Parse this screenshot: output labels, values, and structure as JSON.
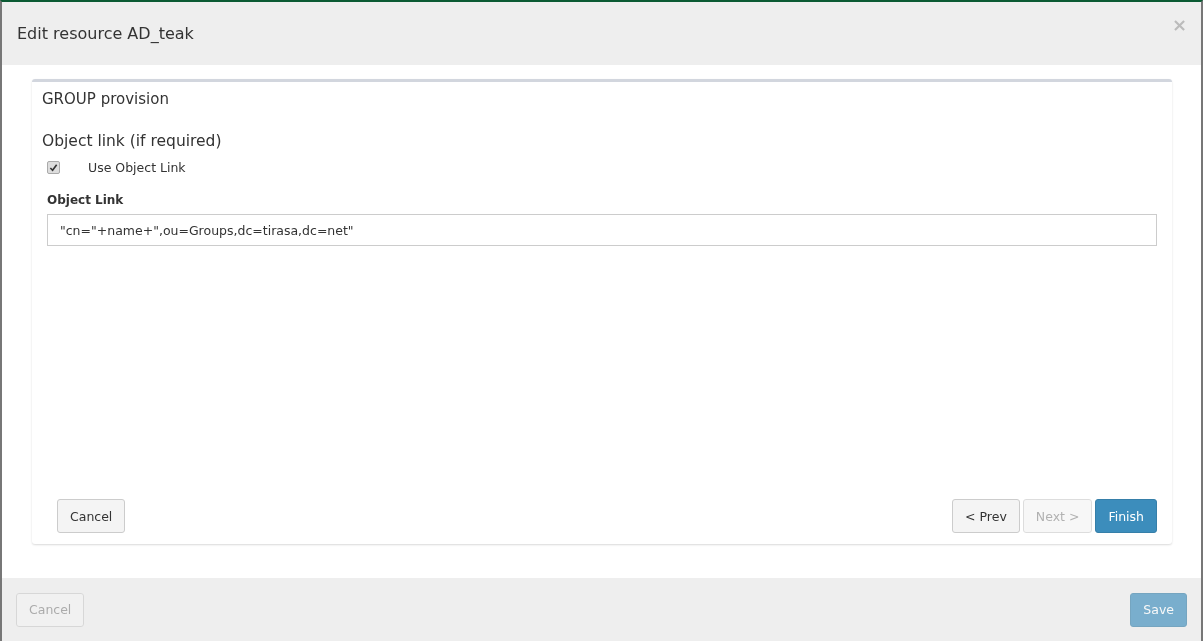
{
  "dialog": {
    "title": "Edit resource AD_teak",
    "close": "×"
  },
  "panel": {
    "title": "GROUP provision",
    "section": "Object link (if required)",
    "checkbox": {
      "label": "Use Object Link",
      "checked": true
    },
    "field": {
      "label": "Object Link",
      "value": "\"cn=\"+name+\",ou=Groups,dc=tirasa,dc=net\""
    },
    "left_buttons": [
      {
        "label": "Cancel",
        "kind": "default",
        "disabled": false
      }
    ],
    "right_buttons": [
      {
        "label": "< Prev",
        "kind": "default",
        "disabled": false
      },
      {
        "label": "Next >",
        "kind": "default",
        "disabled": true
      },
      {
        "label": "Finish",
        "kind": "primary",
        "disabled": false
      }
    ]
  },
  "footer": {
    "buttons": [
      {
        "label": "Cancel",
        "kind": "default",
        "disabled": true
      },
      {
        "label": "Save",
        "kind": "primary",
        "disabled": true
      }
    ]
  }
}
